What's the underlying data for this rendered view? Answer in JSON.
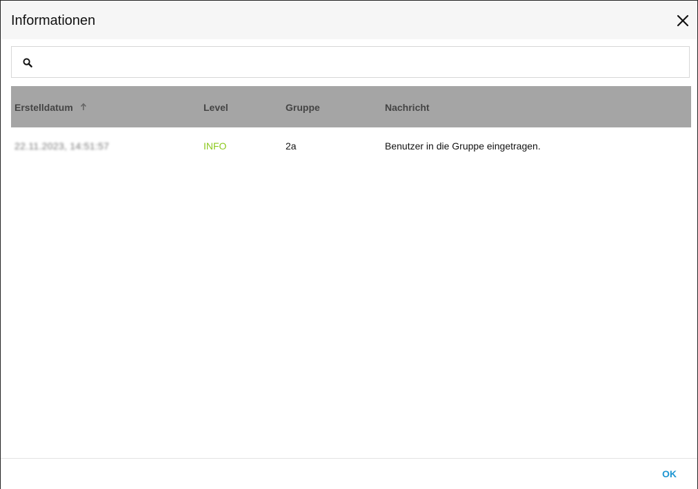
{
  "dialog": {
    "title": "Informationen",
    "close_icon": "close-icon"
  },
  "search": {
    "icon": "search-icon",
    "value": "",
    "placeholder": ""
  },
  "table": {
    "columns": [
      "Erstelldatum",
      "Level",
      "Gruppe",
      "Nachricht"
    ],
    "sort_icon": "arrow-up-icon",
    "rows": [
      {
        "created": "22.11.2023, 14:51:57",
        "level": "INFO",
        "group": "2a",
        "message": "Benutzer in die Gruppe eingetragen."
      }
    ]
  },
  "footer": {
    "ok_label": "OK"
  },
  "colors": {
    "header_bg": "#f6f6f6",
    "table_header_bg": "#a5a5a5",
    "level_info": "#8cc81e",
    "accent": "#1e96d2"
  }
}
